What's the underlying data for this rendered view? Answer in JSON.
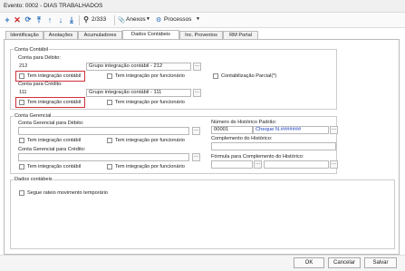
{
  "window": {
    "title": "Evento: 0002 - DIAS TRABALHADOS"
  },
  "toolbar": {
    "record_counter": "2/333",
    "annexes_label": "Anexos",
    "processes_label": "Processos"
  },
  "tabs": [
    "Identificação",
    "Anotações",
    "Acumuladores",
    "Dados Contábeis",
    "Inc. Proventos",
    "RM Portal"
  ],
  "active_tab": "Dados Contábeis",
  "conta_contabil": {
    "section_label": "Conta Contábil",
    "debit_label": "Conta para Débito:",
    "debit_value": "212",
    "debit_group": "Grupo integração contábil - 212",
    "debit_check1": "Tem integração contábil",
    "debit_check2": "Tem integração por funcionário",
    "partial_label": "Contabilização Parcial(*)",
    "credit_label": "Conta para Crédito:",
    "credit_value": "111",
    "credit_group": "Grupo integração contábil - 111",
    "credit_check1": "Tem integração contábil",
    "credit_check2": "Tem integração por funcionário"
  },
  "conta_gerencial": {
    "section_label": "Conta Gerencial",
    "debit_label": "Conta Gerencial para Débito:",
    "debit_check1": "Tem integração contábil",
    "debit_check2": "Tem integração por funcionário",
    "credit_label": "Conta Gerencial para Crédito:",
    "credit_check1": "Tem integração contábil",
    "credit_check2": "Tem integração por funcionário"
  },
  "historico": {
    "number_label": "Número do Histórico Padrão:",
    "number_value": "00001",
    "number_desc": "Cheque N.#######",
    "complement_label": "Complemento do Histórico:",
    "formula_label": "Fórmula para Complemento do Histórico:"
  },
  "dados_contabeis": {
    "section_label": "Dados contábeis",
    "check_label": "Segue rateio movimento temporário"
  },
  "buttons": {
    "ok": "OK",
    "cancel": "Cancelar",
    "save": "Salvar"
  },
  "icons": {
    "browse": "..."
  }
}
